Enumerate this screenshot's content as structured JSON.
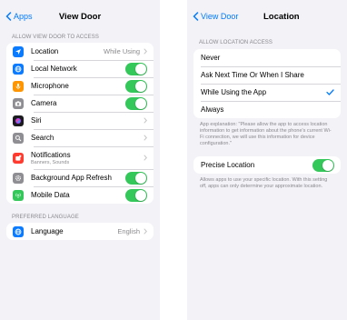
{
  "left": {
    "back_label": "Apps",
    "title": "View Door",
    "section_access": "ALLOW VIEW DOOR TO ACCESS",
    "rows": [
      {
        "label": "Location",
        "value": "While Using",
        "icon": "location-arrow-icon",
        "color": "#0a7aff"
      },
      {
        "label": "Local Network",
        "icon": "globe-icon",
        "color": "#0a7aff"
      },
      {
        "label": "Microphone",
        "icon": "microphone-icon",
        "color": "#ff9500"
      },
      {
        "label": "Camera",
        "icon": "camera-icon",
        "color": "#8e8e93"
      },
      {
        "label": "Siri",
        "icon": "siri-icon",
        "color": "#1c1c1e"
      },
      {
        "label": "Search",
        "icon": "search-icon",
        "color": "#8e8e93"
      },
      {
        "label": "Notifications",
        "sublabel": "Banners, Sounds",
        "icon": "notifications-icon",
        "color": "#ff3b30"
      },
      {
        "label": "Background App Refresh",
        "icon": "gear-icon",
        "color": "#8e8e93"
      },
      {
        "label": "Mobile Data",
        "icon": "antenna-icon",
        "color": "#34c759"
      }
    ],
    "section_language": "PREFERRED LANGUAGE",
    "language_label": "Language",
    "language_value": "English"
  },
  "right": {
    "back_label": "View Door",
    "title": "Location",
    "section_access": "ALLOW LOCATION ACCESS",
    "options": [
      "Never",
      "Ask Next Time Or When I Share",
      "While Using the App",
      "Always"
    ],
    "selected_option": "While Using the App",
    "explanation": "App explanation: \"Please allow the app to access location information to get information about the phone's current Wi-Fi connection, we will use this information for device configuration.\"",
    "precise_label": "Precise Location",
    "precise_note": "Allows apps to use your specific location. With this setting off, apps can only determine your approximate location."
  },
  "colors": {
    "accent": "#007aff",
    "toggle_on": "#34c759"
  }
}
